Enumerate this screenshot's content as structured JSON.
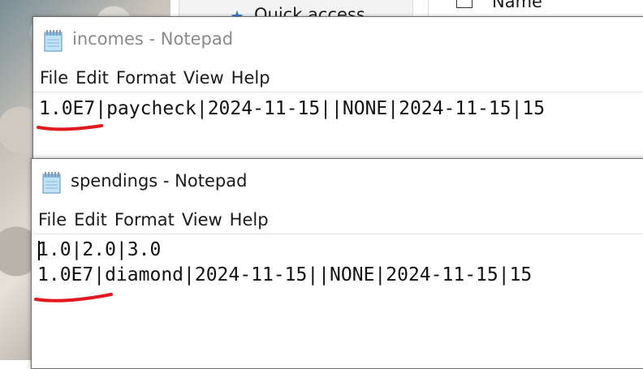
{
  "background": {
    "explorer": {
      "quick_access_label": "Quick access",
      "name_column_header": "Name"
    }
  },
  "windows": [
    {
      "id": "incomes",
      "title": "incomes - Notepad",
      "state": "inactive",
      "menu": [
        "File",
        "Edit",
        "Format",
        "View",
        "Help"
      ],
      "lines": [
        "1.0E7|paycheck|2024-11-15||NONE|2024-11-15|15"
      ]
    },
    {
      "id": "spendings",
      "title": "spendings - Notepad",
      "state": "active",
      "menu": [
        "File",
        "Edit",
        "Format",
        "View",
        "Help"
      ],
      "lines": [
        "1.0|2.0|3.0",
        "1.0E7|diamond|2024-11-15||NONE|2024-11-15|15"
      ]
    }
  ],
  "colors": {
    "annotation_underline": "#e0191e",
    "inactive_title": "#8a8a8a",
    "active_title": "#1a1a1a"
  },
  "icons": {
    "notepad": "notepad-icon",
    "quick_access": "star-icon"
  }
}
